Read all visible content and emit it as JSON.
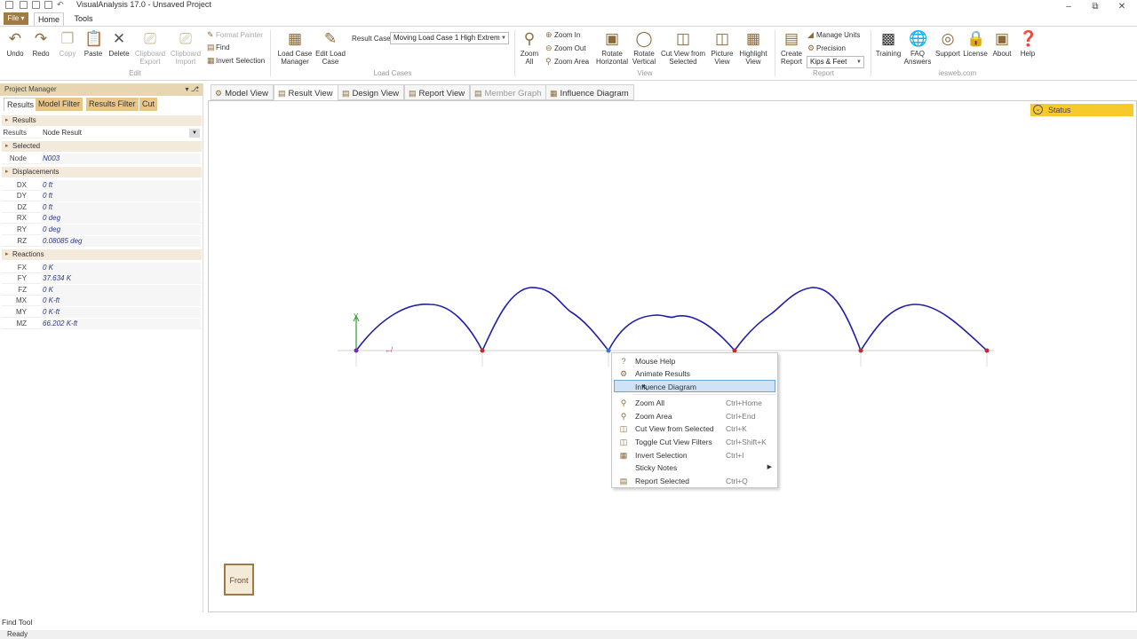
{
  "app": {
    "title": "VisualAnalysis 17.0 - Unsaved Project"
  },
  "menu": {
    "file": "File",
    "tabs": [
      "Home",
      "Tools"
    ]
  },
  "ribbon": {
    "edit": {
      "undo": "Undo",
      "redo": "Redo",
      "copy": "Copy",
      "paste": "Paste",
      "delete": "Delete",
      "clipboard_export": "Clipboard Export",
      "clipboard_import": "Clipboard Import",
      "format_painter": "Format Painter",
      "find": "Find",
      "invert_selection": "Invert Selection",
      "group": "Edit"
    },
    "load_cases": {
      "manager": "Load Case Manager",
      "edit": "Edit Load Case",
      "result_case_label": "Result Case",
      "result_case_value": "Moving Load Case 1 High Extrem",
      "group": "Load Cases"
    },
    "view": {
      "zoom_all": "Zoom All",
      "zoom_in": "Zoom In",
      "zoom_out": "Zoom Out",
      "zoom_area": "Zoom Area",
      "rotate_horizontal": "Rotate Horizontal",
      "rotate_vertical": "Rotate Vertical",
      "cut_view": "Cut View from Selected",
      "picture_view": "Picture View",
      "highlight_view": "Highlight View",
      "group": "View"
    },
    "report": {
      "create": "Create Report",
      "manage_units": "Manage Units",
      "precision": "Precision",
      "units_value": "Kips & Feet",
      "group": "Report"
    },
    "iesweb": {
      "training": "Training",
      "faq": "FAQ Answers",
      "support": "Support",
      "license": "License",
      "about": "About",
      "help": "Help",
      "group": "iesweb.com"
    }
  },
  "project_manager": {
    "title": "Project Manager",
    "tabs": [
      "Results",
      "Model Filter",
      "Results Filter",
      "Cut"
    ],
    "results_header": "Results",
    "results_row": {
      "key": "Results",
      "value": "Node Result"
    },
    "selected_header": "Selected",
    "node_row": {
      "key": "Node",
      "value": "N003"
    },
    "displacements_header": "Displacements",
    "displacements": [
      {
        "key": "DX",
        "value": "0 ft"
      },
      {
        "key": "DY",
        "value": "0 ft"
      },
      {
        "key": "DZ",
        "value": "0 ft"
      },
      {
        "key": "RX",
        "value": "0 deg"
      },
      {
        "key": "RY",
        "value": "0 deg"
      },
      {
        "key": "RZ",
        "value": "0.08085 deg"
      }
    ],
    "reactions_header": "Reactions",
    "reactions": [
      {
        "key": "FX",
        "value": "0 K"
      },
      {
        "key": "FY",
        "value": "37.634 K"
      },
      {
        "key": "FZ",
        "value": "0 K"
      },
      {
        "key": "MX",
        "value": "0 K-ft"
      },
      {
        "key": "MY",
        "value": "0 K-ft"
      },
      {
        "key": "MZ",
        "value": "66.202 K-ft"
      }
    ]
  },
  "view_tabs": [
    "Model View",
    "Result View",
    "Design View",
    "Report View",
    "Member Graph",
    "Influence Diagram"
  ],
  "status": {
    "label": "Status"
  },
  "axis": {
    "y": "Y"
  },
  "front_button": "Front",
  "context_menu": [
    {
      "label": "Mouse Help",
      "shortcut": "",
      "icon": "question-icon"
    },
    {
      "label": "Animate Results",
      "shortcut": "",
      "icon": "animate-icon"
    },
    {
      "label": "Influence Diagram",
      "shortcut": "",
      "icon": ""
    },
    {
      "label": "Zoom All",
      "shortcut": "Ctrl+Home",
      "icon": "zoom-icon"
    },
    {
      "label": "Zoom Area",
      "shortcut": "Ctrl+End",
      "icon": "zoom-area-icon"
    },
    {
      "label": "Cut View from Selected",
      "shortcut": "Ctrl+K",
      "icon": "cut-view-icon"
    },
    {
      "label": "Toggle Cut View Filters",
      "shortcut": "Ctrl+Shift+K",
      "icon": "filter-icon"
    },
    {
      "label": "Invert Selection",
      "shortcut": "Ctrl+I",
      "icon": "invert-icon"
    },
    {
      "label": "Sticky Notes",
      "shortcut": "",
      "icon": ""
    },
    {
      "label": "Report Selected",
      "shortcut": "Ctrl+Q",
      "icon": "report-icon"
    }
  ],
  "bottom": {
    "find_tool": "Find Tool",
    "status_text": "Ready"
  },
  "colors": {
    "accent": "#8a6a3a",
    "curve": "#1f1fa8",
    "highlight": "#cfe3f7",
    "status": "#f7c92a"
  }
}
